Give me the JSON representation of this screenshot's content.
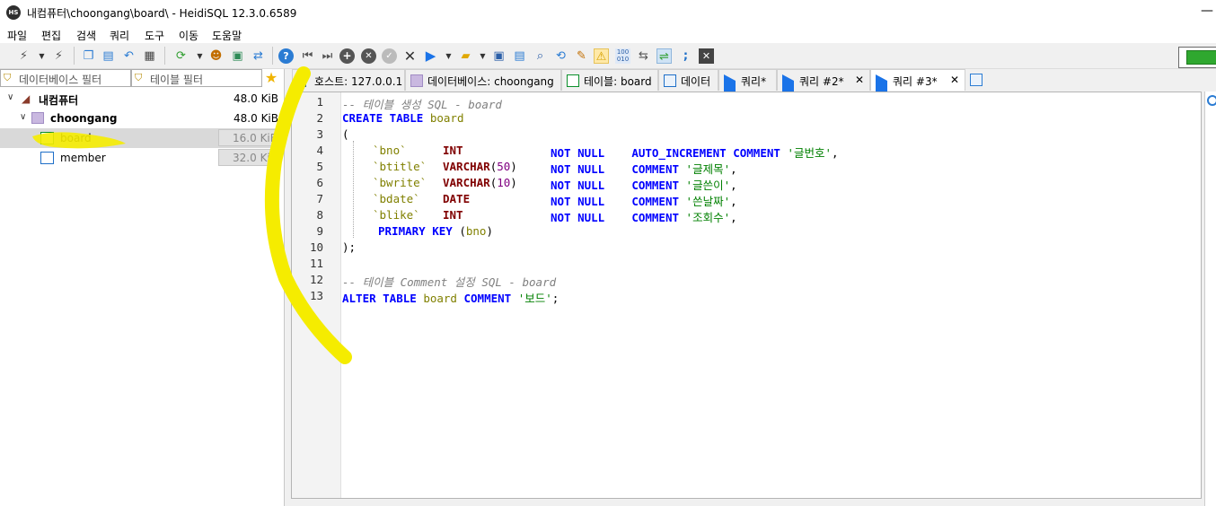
{
  "window": {
    "title": "내컴퓨터\\choongang\\board\\ - HeidiSQL 12.3.0.6589",
    "app_icon": "HS",
    "minimize_glyph": "—"
  },
  "menu": [
    "파일",
    "편집",
    "검색",
    "쿼리",
    "도구",
    "이동",
    "도움말"
  ],
  "filters": {
    "database_placeholder": "데이터베이스 필터",
    "table_placeholder": "테이블 필터"
  },
  "tree": {
    "root": {
      "label": "내컴퓨터",
      "size": "48.0 KiB"
    },
    "db": {
      "label": "choongang",
      "size": "48.0 KiB"
    },
    "tables": [
      {
        "label": "board",
        "size": "16.0 KiB",
        "selected": true
      },
      {
        "label": "member",
        "size": "32.0 KiB",
        "selected": false
      }
    ]
  },
  "tabs": [
    {
      "label": "호스트: 127.0.0.1",
      "icon": "host-icon"
    },
    {
      "label": "데이터베이스: choongang",
      "icon": "database-icon"
    },
    {
      "label": "테이블: board",
      "icon": "table-icon"
    },
    {
      "label": "데이터",
      "icon": "data-grid-icon"
    },
    {
      "label": "쿼리*",
      "icon": "query-play-icon"
    },
    {
      "label": "쿼리 #2*",
      "icon": "query-play-icon",
      "closable": true
    },
    {
      "label": "쿼리 #3*",
      "icon": "query-play-icon",
      "closable": true,
      "active": true
    }
  ],
  "tab_close_glyph": "✕",
  "editor": {
    "line_numbers": [
      "1",
      "2",
      "3",
      "4",
      "5",
      "6",
      "7",
      "8",
      "9",
      "10",
      "11",
      "12",
      "13"
    ]
  },
  "colors": {
    "keyword": "#0000ff",
    "type": "#800000",
    "comment": "#808080",
    "string": "#008000",
    "identifier": "#808000",
    "number": "#800080",
    "highlight": "#f5ec00",
    "battery": "#2fa82f"
  }
}
